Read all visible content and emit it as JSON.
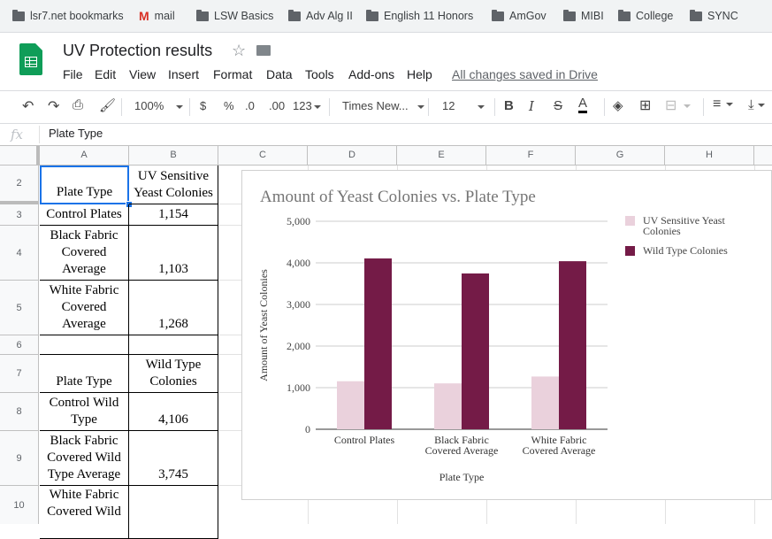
{
  "bookmarks": [
    {
      "label": "lsr7.net bookmarks",
      "icon": "bookmark-folder-icon"
    },
    {
      "label": "mail",
      "icon": "gmail-icon"
    },
    {
      "label": "LSW Basics",
      "icon": "folder-icon"
    },
    {
      "label": "Adv Alg II",
      "icon": "folder-icon"
    },
    {
      "label": "English 11 Honors",
      "icon": "folder-icon"
    },
    {
      "label": "AmGov",
      "icon": "folder-icon"
    },
    {
      "label": "MIBI",
      "icon": "folder-icon"
    },
    {
      "label": "College",
      "icon": "folder-icon"
    },
    {
      "label": "SYNC",
      "icon": "folder-icon"
    }
  ],
  "document": {
    "title": "UV Protection results",
    "saved_status": "All changes saved in Drive"
  },
  "menu": [
    "File",
    "Edit",
    "View",
    "Insert",
    "Format",
    "Data",
    "Tools",
    "Add-ons",
    "Help"
  ],
  "toolbar": {
    "zoom": "100%",
    "currency": "$",
    "percent": "%",
    "decrease_decimals": ".0",
    "increase_decimals": ".00",
    "more_formats": "123",
    "font": "Times New...",
    "font_size": "12",
    "bold": "B",
    "italic": "I",
    "strikethrough": "S",
    "text_color": "A"
  },
  "formula_bar": {
    "label": "fx",
    "value": "Plate Type"
  },
  "columns": [
    "A",
    "B",
    "C",
    "D",
    "E",
    "F",
    "G",
    "H"
  ],
  "rows": [
    "2",
    "3",
    "4",
    "5",
    "6",
    "7",
    "8",
    "9",
    "10"
  ],
  "cells": {
    "a2": [
      "Plate Type"
    ],
    "b2": [
      "UV Sensitive",
      "Yeast Colonies"
    ],
    "a3": [
      "Control Plates"
    ],
    "b3": [
      "1,154"
    ],
    "a4": [
      "Black Fabric",
      "Covered",
      "Average"
    ],
    "b4": [
      "1,103"
    ],
    "a5": [
      "White Fabric",
      "Covered",
      "Average"
    ],
    "b5": [
      "1,268"
    ],
    "a7": [
      "Plate Type"
    ],
    "b7": [
      "Wild Type",
      "Colonies"
    ],
    "a8": [
      "Control Wild",
      "Type"
    ],
    "b8": [
      "4,106"
    ],
    "a9": [
      "Black Fabric",
      "Covered Wild",
      "Type Average"
    ],
    "b9": [
      "3,745"
    ],
    "a10": [
      "White Fabric",
      "Covered Wild"
    ]
  },
  "chart_data": {
    "type": "bar",
    "title": "Amount of Yeast Colonies vs. Plate Type",
    "xlabel": "Plate Type",
    "ylabel": "Amount of Yeast Colonies",
    "categories": [
      [
        "Control Plates"
      ],
      [
        "Black Fabric",
        "Covered Average"
      ],
      [
        "White Fabric",
        "Covered Average"
      ]
    ],
    "series": [
      {
        "name": "UV Sensitive Yeast Colonies",
        "name_lines": [
          "UV Sensitive Yeast",
          "Colonies"
        ],
        "color": "#ead1dc",
        "values": [
          1154,
          1103,
          1268
        ]
      },
      {
        "name": "Wild Type Colonies",
        "name_lines": [
          "Wild Type Colonies"
        ],
        "color": "#741b47",
        "values": [
          4106,
          3745,
          4040
        ]
      }
    ],
    "ylim": [
      0,
      5000
    ],
    "yticks": [
      0,
      1000,
      2000,
      3000,
      4000,
      5000
    ],
    "ytick_labels": [
      "0",
      "1,000",
      "2,000",
      "3,000",
      "4,000",
      "5,000"
    ],
    "grid": true,
    "legend": "right"
  }
}
